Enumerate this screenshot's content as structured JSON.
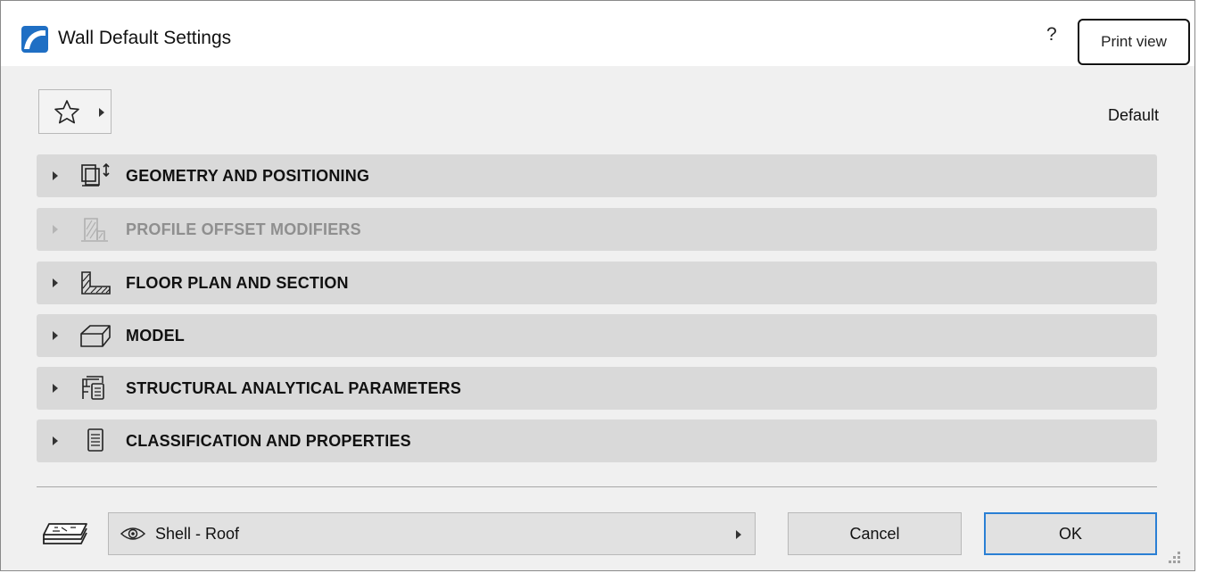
{
  "window": {
    "title": "Wall Default Settings",
    "help_label": "?",
    "app_icon": "archicad-logo-icon"
  },
  "overlay": {
    "print_view_label": "Print view"
  },
  "favorites": {
    "icon": "star-icon",
    "current_label": "Default"
  },
  "panels": [
    {
      "label": "GEOMETRY AND POSITIONING",
      "icon": "geometry-icon",
      "enabled": true
    },
    {
      "label": "PROFILE OFFSET MODIFIERS",
      "icon": "profile-offset-icon",
      "enabled": false
    },
    {
      "label": "FLOOR PLAN AND SECTION",
      "icon": "floor-plan-icon",
      "enabled": true
    },
    {
      "label": "MODEL",
      "icon": "model-icon",
      "enabled": true
    },
    {
      "label": "STRUCTURAL ANALYTICAL PARAMETERS",
      "icon": "structural-icon",
      "enabled": true
    },
    {
      "label": "CLASSIFICATION AND PROPERTIES",
      "icon": "classification-icon",
      "enabled": true
    }
  ],
  "footer": {
    "layer_icon": "layers-icon",
    "layer_visibility_icon": "eye-icon",
    "layer_value": "Shell - Roof",
    "cancel_label": "Cancel",
    "ok_label": "OK"
  },
  "colors": {
    "accent": "#2a7fd4",
    "panel_bg": "#d9d9d9",
    "dialog_bg": "#f0f0f0"
  }
}
